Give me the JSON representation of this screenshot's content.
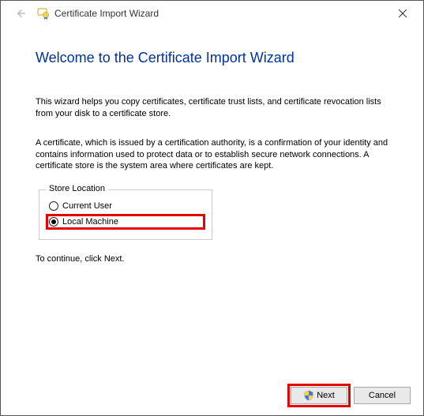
{
  "window": {
    "title": "Certificate Import Wizard"
  },
  "main": {
    "heading": "Welcome to the Certificate Import Wizard",
    "para1": "This wizard helps you copy certificates, certificate trust lists, and certificate revocation lists from your disk to a certificate store.",
    "para2": "A certificate, which is issued by a certification authority, is a confirmation of your identity and contains information used to protect data or to establish secure network connections. A certificate store is the system area where certificates are kept.",
    "storeLocation": {
      "legend": "Store Location",
      "option1": "Current User",
      "option2": "Local Machine",
      "selected": "Local Machine"
    },
    "continueText": "To continue, click Next."
  },
  "footer": {
    "next": "Next",
    "cancel": "Cancel"
  }
}
